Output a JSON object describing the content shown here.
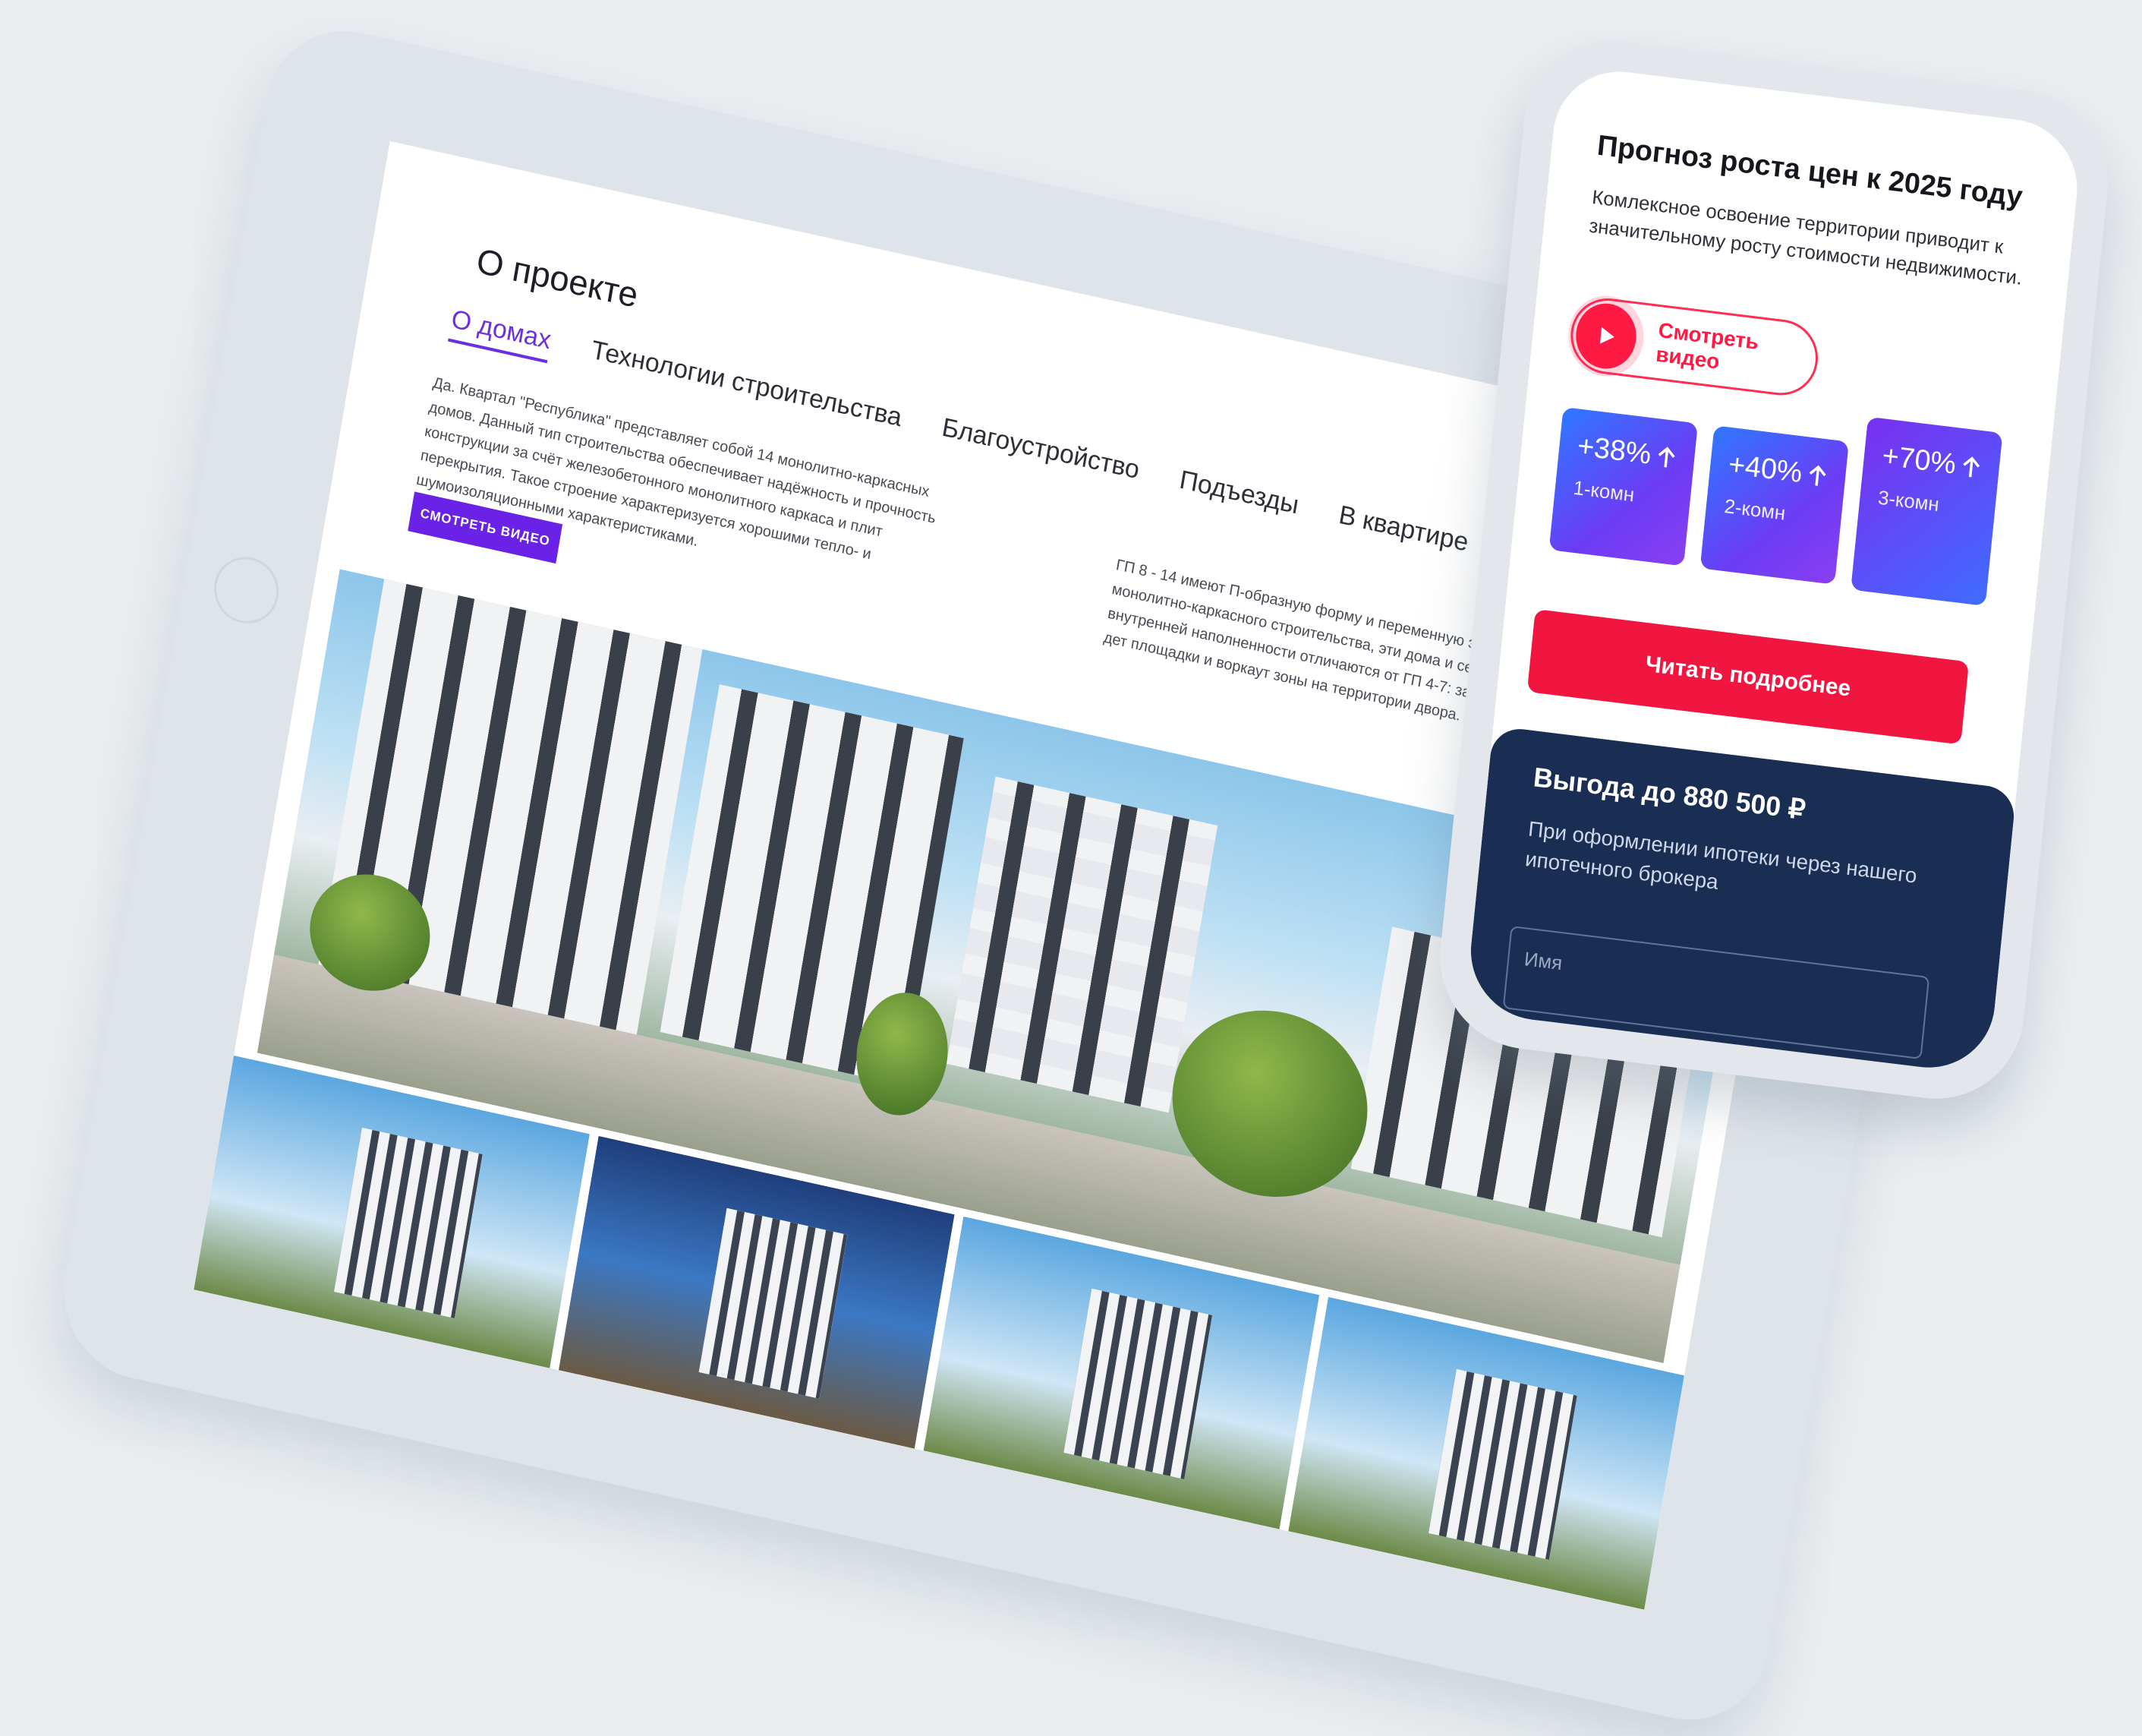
{
  "tablet": {
    "section_title": "О проекте",
    "tabs": [
      {
        "label": "О домах",
        "active": true
      },
      {
        "label": "Технологии строительства",
        "active": false
      },
      {
        "label": "Благоустройство",
        "active": false
      },
      {
        "label": "Подъезды",
        "active": false
      },
      {
        "label": "В квартире",
        "active": false
      }
    ],
    "paragraph_left": "Да. Квартал \"Республика\" представляет собой 14 монолитно-каркасных домов. Данный тип строительства обеспечивает надёжность и прочность конструкции за счёт железобетонного монолитного каркаса и плит перекрытия. Такое строение характеризуется хорошими тепло- и шумоизоляционными характеристиками.",
    "paragraph_right": "ГП 8 - 14 имеют П-образную форму и переменную этажность - 8 и 1 этажей. Помимо монолитно-каркасного строительства, эти дома и секции из керамического кирпича. По внутренней наполненности отличаются от ГП 4-7: закрытая территория, места для отдыха, дет площадки и воркаут зоны на территории двора.",
    "video_button": "СМОТРЕТЬ ВИДЕО"
  },
  "phone": {
    "title": "Прогноз роста цен к 2025 году",
    "subtitle": "Комлексное освоение территории приводит к значительному росту стоимости недвижимости.",
    "video_button": "Смотреть видео",
    "stats": [
      {
        "value": "+38%",
        "label": "1-комн"
      },
      {
        "value": "+40%",
        "label": "2-комн"
      },
      {
        "value": "+70%",
        "label": "3-комн"
      }
    ],
    "cta": "Читать подробнее",
    "offer_title": "Выгода до 880 500 ₽",
    "offer_sub": "При оформлении ипотеки через нашего ипотечного брокера",
    "name_field_placeholder": "Имя"
  },
  "colors": {
    "accent_purple": "#6a22e6",
    "accent_red": "#f0163f",
    "dark_navy": "#1a2e53",
    "stat_gradient_start": "#2f78ff",
    "stat_gradient_end": "#8a3ff0"
  },
  "icons": [
    "play-icon",
    "arrow-up-icon"
  ]
}
